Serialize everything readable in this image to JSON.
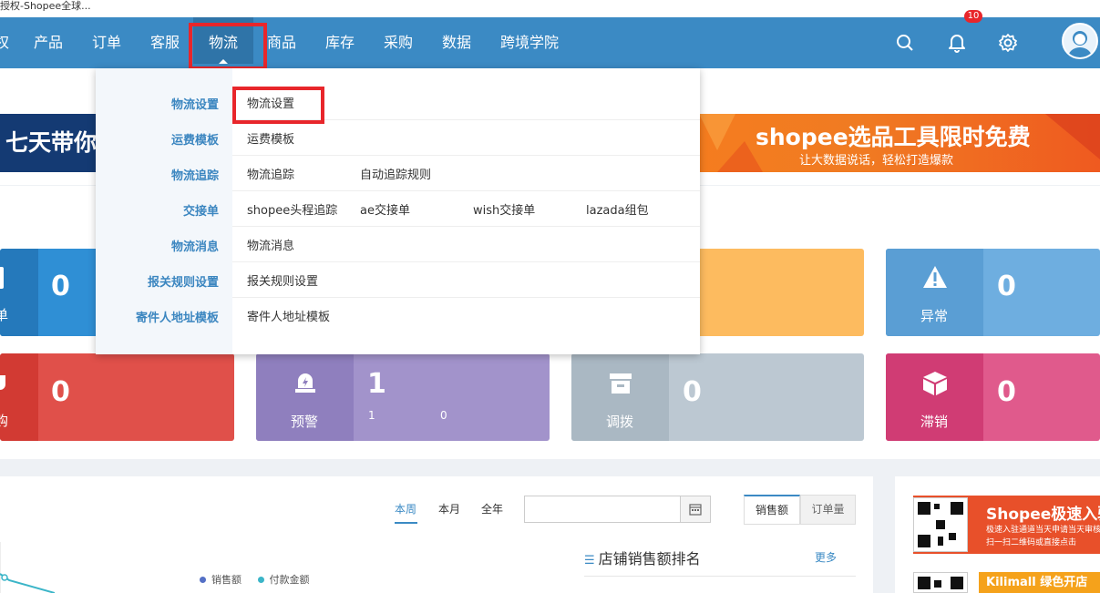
{
  "browser_tab": {
    "title": "授权-Shopee全球..."
  },
  "nav": {
    "items": [
      "权",
      "产品",
      "订单",
      "客服",
      "物流",
      "商品",
      "库存",
      "采购",
      "数据",
      "跨境学院"
    ],
    "active": "物流",
    "notification_count": "10",
    "icons": [
      "search-icon",
      "bell-icon",
      "gear-icon",
      "avatar"
    ]
  },
  "dropdown": {
    "categories": [
      "物流设置",
      "运费模板",
      "物流追踪",
      "交接单",
      "物流消息",
      "报关规则设置",
      "寄件人地址模板"
    ],
    "rows": [
      [
        "物流设置"
      ],
      [
        "运费模板"
      ],
      [
        "物流追踪",
        "自动追踪规则"
      ],
      [
        "shopee头程追踪",
        "ae交接单",
        "wish交接单",
        "lazada组包"
      ],
      [
        "物流消息"
      ],
      [
        "报关规则设置"
      ],
      [
        "寄件人地址模板"
      ]
    ]
  },
  "banners": {
    "left_text": "七天带你",
    "right_title": "shopee选品工具限时免费",
    "right_sub": "让大数据说话，轻松打造爆款"
  },
  "cards": {
    "c1": {
      "label": "单",
      "value": "0",
      "color": "#2f8fd5",
      "icon": "doc-icon"
    },
    "c2": {
      "label": "",
      "value": "",
      "color": "#fdbb5f"
    },
    "c3": {
      "label": "异常",
      "value": "0",
      "color": "#6eaee0",
      "icon": "warning-icon"
    },
    "c4": {
      "label": "购",
      "value": "0",
      "color": "#e0504a",
      "icon": "cart-icon"
    },
    "c5": {
      "label": "预警",
      "value": "1",
      "sub1": "1",
      "sub2": "0",
      "color": "#9a88c3",
      "icon": "alert-icon"
    },
    "c6": {
      "label": "调拨",
      "value": "0",
      "color": "#b8c6d1",
      "icon": "store-icon"
    },
    "c7": {
      "label": "滞销",
      "value": "0",
      "color": "#e04f85",
      "icon": "box-icon"
    }
  },
  "chart_panel": {
    "tabs": [
      "本周",
      "本月",
      "全年"
    ],
    "active_tab": "本周",
    "segments": [
      "销售额",
      "订单量"
    ],
    "active_segment": "销售额",
    "legend": [
      "销售额",
      "付款金额"
    ],
    "ranking_title": "店铺销售额排名",
    "more": "更多"
  },
  "side_ads": {
    "ad1_title": "Shopee极速入驻",
    "ad1_sub1": "极速入驻通道当天申请当天审核",
    "ad1_sub2": "扫一扫二维码或直接点击",
    "ad2_title": "Kilimall 绿色开店"
  }
}
